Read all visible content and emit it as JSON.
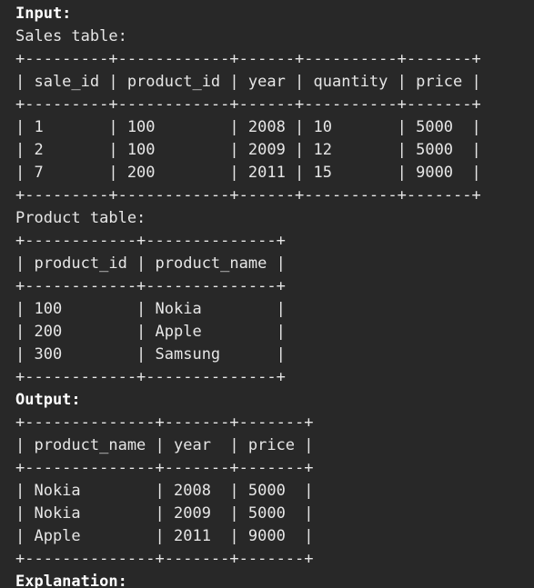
{
  "input_heading": "Input:",
  "sales_table": {
    "title": "Sales table:",
    "border": "+---------+------------+------+----------+-------+",
    "header": "| sale_id | product_id | year | quantity | price |",
    "rows": [
      "| 1       | 100        | 2008 | 10       | 5000  |",
      "| 2       | 100        | 2009 | 12       | 5000  |",
      "| 7       | 200        | 2011 | 15       | 9000  |"
    ]
  },
  "product_table": {
    "title": "Product table:",
    "border": "+------------+--------------+",
    "header": "| product_id | product_name |",
    "rows": [
      "| 100        | Nokia        |",
      "| 200        | Apple        |",
      "| 300        | Samsung      |"
    ]
  },
  "output_heading": "Output:",
  "output_table": {
    "border": "+--------------+-------+-------+",
    "header": "| product_name | year  | price |",
    "rows": [
      "| Nokia        | 2008  | 5000  |",
      "| Nokia        | 2009  | 5000  |",
      "| Apple        | 2011  | 9000  |"
    ]
  },
  "explanation_heading": "Explanation:"
}
